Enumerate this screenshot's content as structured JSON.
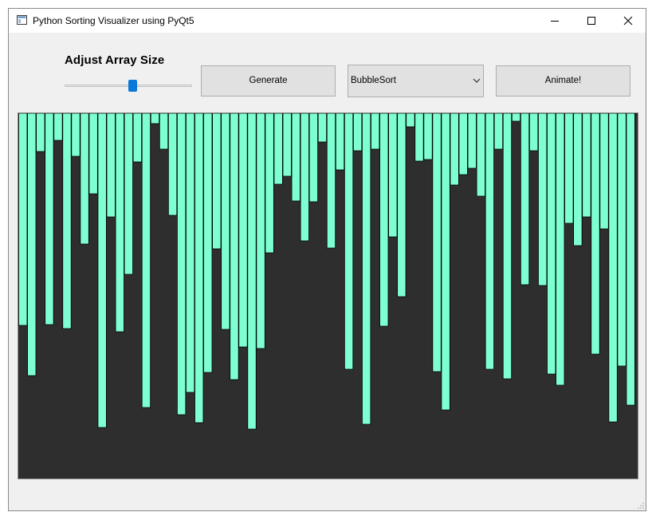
{
  "window": {
    "title": "Python Sorting Visualizer using PyQt5",
    "controls": {
      "minimize_icon": "minimize-icon",
      "maximize_icon": "maximize-icon",
      "close_icon": "close-icon"
    }
  },
  "controls": {
    "size_label": "Adjust Array  Size",
    "size_slider": {
      "value_fraction": 0.54
    },
    "generate_label": "Generate",
    "algorithm_select": {
      "selected": "BubbleSort"
    },
    "animate_label": "Animate!"
  },
  "colors": {
    "bar_fill": "#7effd2",
    "bar_stroke": "#000000",
    "canvas_background": "#2e2e2e",
    "slider_thumb": "#0a78d7"
  },
  "chart_data": {
    "type": "bar",
    "ylim": [
      0,
      457
    ],
    "values": [
      266,
      329,
      48,
      265,
      34,
      270,
      54,
      164,
      101,
      394,
      130,
      274,
      202,
      61,
      369,
      13,
      45,
      128,
      378,
      350,
      388,
      325,
      170,
      271,
      334,
      293,
      396,
      295,
      175,
      89,
      79,
      110,
      160,
      111,
      36,
      169,
      71,
      321,
      47,
      390,
      45,
      267,
      155,
      230,
      17,
      60,
      58,
      324,
      372,
      90,
      77,
      69,
      104,
      321,
      45,
      333,
      10,
      215,
      47,
      216,
      327,
      341,
      138,
      166,
      130,
      302,
      145,
      387,
      317,
      366,
      1
    ]
  }
}
